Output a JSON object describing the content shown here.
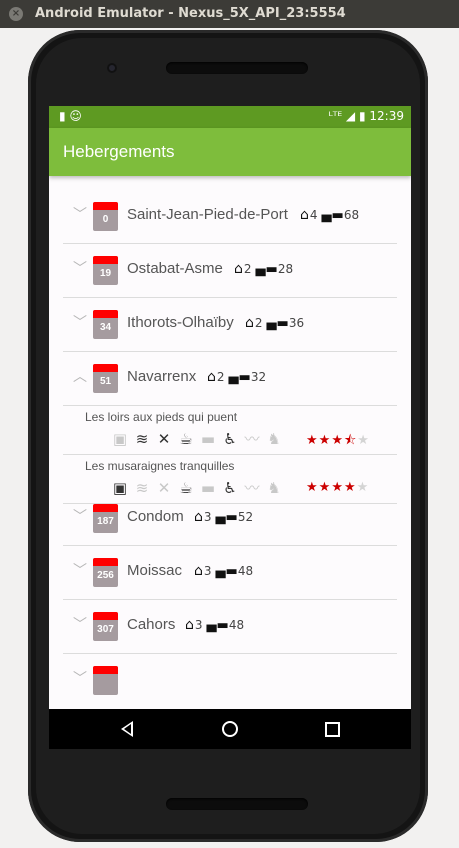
{
  "window": {
    "title": "Android Emulator - Nexus_5X_API_23:5554"
  },
  "status": {
    "left_icons": "▮ ☺",
    "right_icons": "ᴸᵀᴱ ◢ ▮",
    "time": "12:39"
  },
  "app": {
    "title": "Hebergements"
  },
  "stages": [
    {
      "num": "0",
      "city": "Saint-Jean-Pied-de-Port",
      "houses": "4",
      "beds": "68",
      "expanded": false
    },
    {
      "num": "19",
      "city": "Ostabat-Asme",
      "houses": "2",
      "beds": "28",
      "expanded": false
    },
    {
      "num": "34",
      "city": "Ithorots-Olhaïby",
      "houses": "2",
      "beds": "36",
      "expanded": false
    },
    {
      "num": "51",
      "city": "Navarrenx",
      "houses": "2",
      "beds": "32",
      "expanded": true
    },
    {
      "num": "187",
      "city": "Condom",
      "houses": "3",
      "beds": "52",
      "expanded": false
    },
    {
      "num": "256",
      "city": "Moissac",
      "houses": "3",
      "beds": "48",
      "expanded": false
    },
    {
      "num": "307",
      "city": "Cahors",
      "houses": "3",
      "beds": "48",
      "expanded": false
    }
  ],
  "lodgings": [
    {
      "name": "Les loirs aux pieds qui puent",
      "amenities": [
        false,
        true,
        true,
        true,
        false,
        true,
        false,
        false
      ],
      "rating": 3.5
    },
    {
      "name": "Les musaraignes tranquilles",
      "amenities": [
        true,
        false,
        false,
        true,
        false,
        true,
        false,
        false
      ],
      "rating": 4
    }
  ],
  "icons": {
    "house": "house-icon",
    "bed": "bed-icon",
    "calendar": "calendar-icon",
    "chevron": "chevron-icon"
  },
  "colors": {
    "appbar": "#7ebd3c",
    "statusbar": "#5e9a22",
    "calendar_top": "#ff0000",
    "star": "#cc0000"
  }
}
